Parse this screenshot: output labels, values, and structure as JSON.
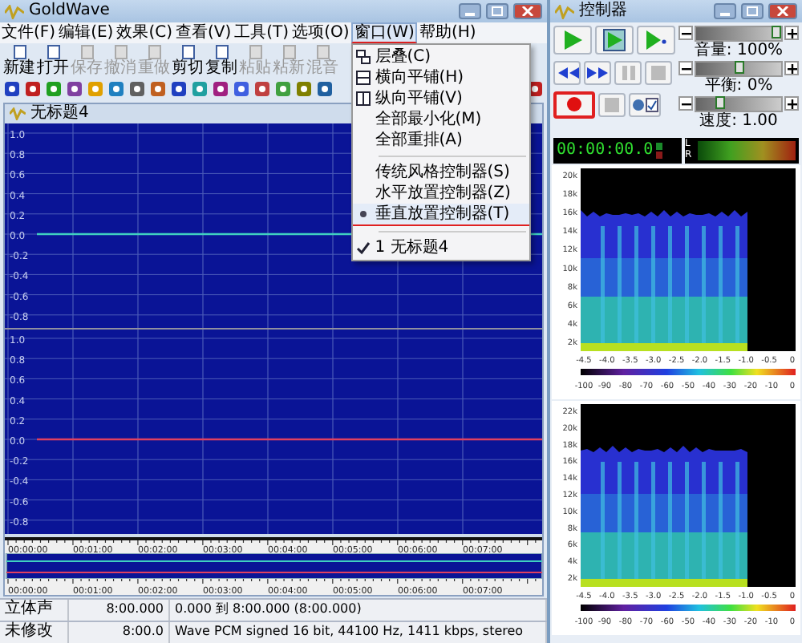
{
  "window": {
    "title": "GoldWave"
  },
  "menu_bar": [
    {
      "label": "文件(F)",
      "selected": false
    },
    {
      "label": "编辑(E)",
      "selected": false
    },
    {
      "label": "效果(C)",
      "selected": false
    },
    {
      "label": "查看(V)",
      "selected": false
    },
    {
      "label": "工具(T)",
      "selected": false
    },
    {
      "label": "选项(O)",
      "selected": false
    },
    {
      "label": "窗口(W)",
      "selected": true
    },
    {
      "label": "帮助(H)",
      "selected": false
    }
  ],
  "window_menu": {
    "groups": [
      [
        {
          "label": "层叠(C)"
        },
        {
          "label": "横向平铺(H)"
        },
        {
          "label": "纵向平铺(V)"
        },
        {
          "label": "全部最小化(M)"
        },
        {
          "label": "全部重排(A)"
        }
      ],
      [
        {
          "label": "传统风格控制器(S)",
          "selected": false
        },
        {
          "label": "水平放置控制器(Z)",
          "selected": false
        },
        {
          "label": "垂直放置控制器(T)",
          "selected": true
        }
      ],
      [
        {
          "label": "1 无标题4",
          "checked": true
        }
      ]
    ]
  },
  "toolbar": [
    {
      "label": "新建",
      "disabled": false
    },
    {
      "label": "打开",
      "disabled": false
    },
    {
      "label": "保存",
      "disabled": true
    },
    {
      "label": "撤消",
      "disabled": true
    },
    {
      "label": "重做",
      "disabled": true
    },
    {
      "label": "剪切",
      "disabled": false
    },
    {
      "label": "复制",
      "disabled": false
    },
    {
      "label": "粘贴",
      "disabled": true
    },
    {
      "label": "粘新",
      "disabled": true
    },
    {
      "label": "混音",
      "disabled": true
    }
  ],
  "document": {
    "title": "无标题4",
    "channels": [
      {
        "labels": [
          "1.0",
          "0.8",
          "0.6",
          "0.4",
          "0.2",
          "0.0",
          "-0.2",
          "-0.4",
          "-0.6",
          "-0.8"
        ]
      },
      {
        "labels": [
          "1.0",
          "0.8",
          "0.6",
          "0.4",
          "0.2",
          "0.0",
          "-0.2",
          "-0.4",
          "-0.6",
          "-0.8"
        ]
      }
    ],
    "time_labels": [
      "00:00:00",
      "00:01:00",
      "00:02:00",
      "00:03:00",
      "00:04:00",
      "00:05:00",
      "00:06:00",
      "00:07:00"
    ],
    "overview_time_labels": [
      "00:00:00",
      "00:01:00",
      "00:02:00",
      "00:03:00",
      "00:04:00",
      "00:05:00",
      "00:06:00",
      "00:07:00"
    ]
  },
  "status_bar": [
    [
      "立体声",
      "8:00.000",
      "0.000 到 8:00.000 (8:00.000)"
    ],
    [
      "未修改",
      "8:00.0",
      "Wave PCM signed 16 bit, 44100 Hz, 1411 kbps, stereo"
    ]
  ],
  "controller": {
    "title": "控制器",
    "sliders": [
      {
        "label": "音量: 100%",
        "level": 1
      },
      {
        "label": "平衡: 0%",
        "level": 0.5
      },
      {
        "label": "速度: 1.00",
        "level": 0.25
      }
    ],
    "timer": "00:00:00.0",
    "meter": [
      "L",
      "R"
    ],
    "spectrograms": [
      {
        "y_labels": [
          "20k",
          "18k",
          "16k",
          "14k",
          "12k",
          "10k",
          "8k",
          "6k",
          "4k",
          "2k"
        ],
        "x_labels": [
          "-4.5",
          "-4.0",
          "-3.5",
          "-3.0",
          "-2.5",
          "-2.0",
          "-1.5",
          "-1.0",
          "-0.5",
          "0"
        ],
        "scale_labels": [
          "-100",
          "-90",
          "-80",
          "-70",
          "-60",
          "-50",
          "-40",
          "-30",
          "-20",
          "-10",
          "0"
        ]
      },
      {
        "y_labels": [
          "22k",
          "20k",
          "18k",
          "16k",
          "14k",
          "12k",
          "10k",
          "8k",
          "6k",
          "4k",
          "2k"
        ],
        "x_labels": [
          "-4.5",
          "-4.0",
          "-3.5",
          "-3.0",
          "-2.5",
          "-2.0",
          "-1.5",
          "-1.0",
          "-0.5",
          "0"
        ],
        "scale_labels": [
          "-100",
          "-90",
          "-80",
          "-70",
          "-60",
          "-50",
          "-40",
          "-30",
          "-20",
          "-10",
          "0"
        ]
      }
    ]
  }
}
